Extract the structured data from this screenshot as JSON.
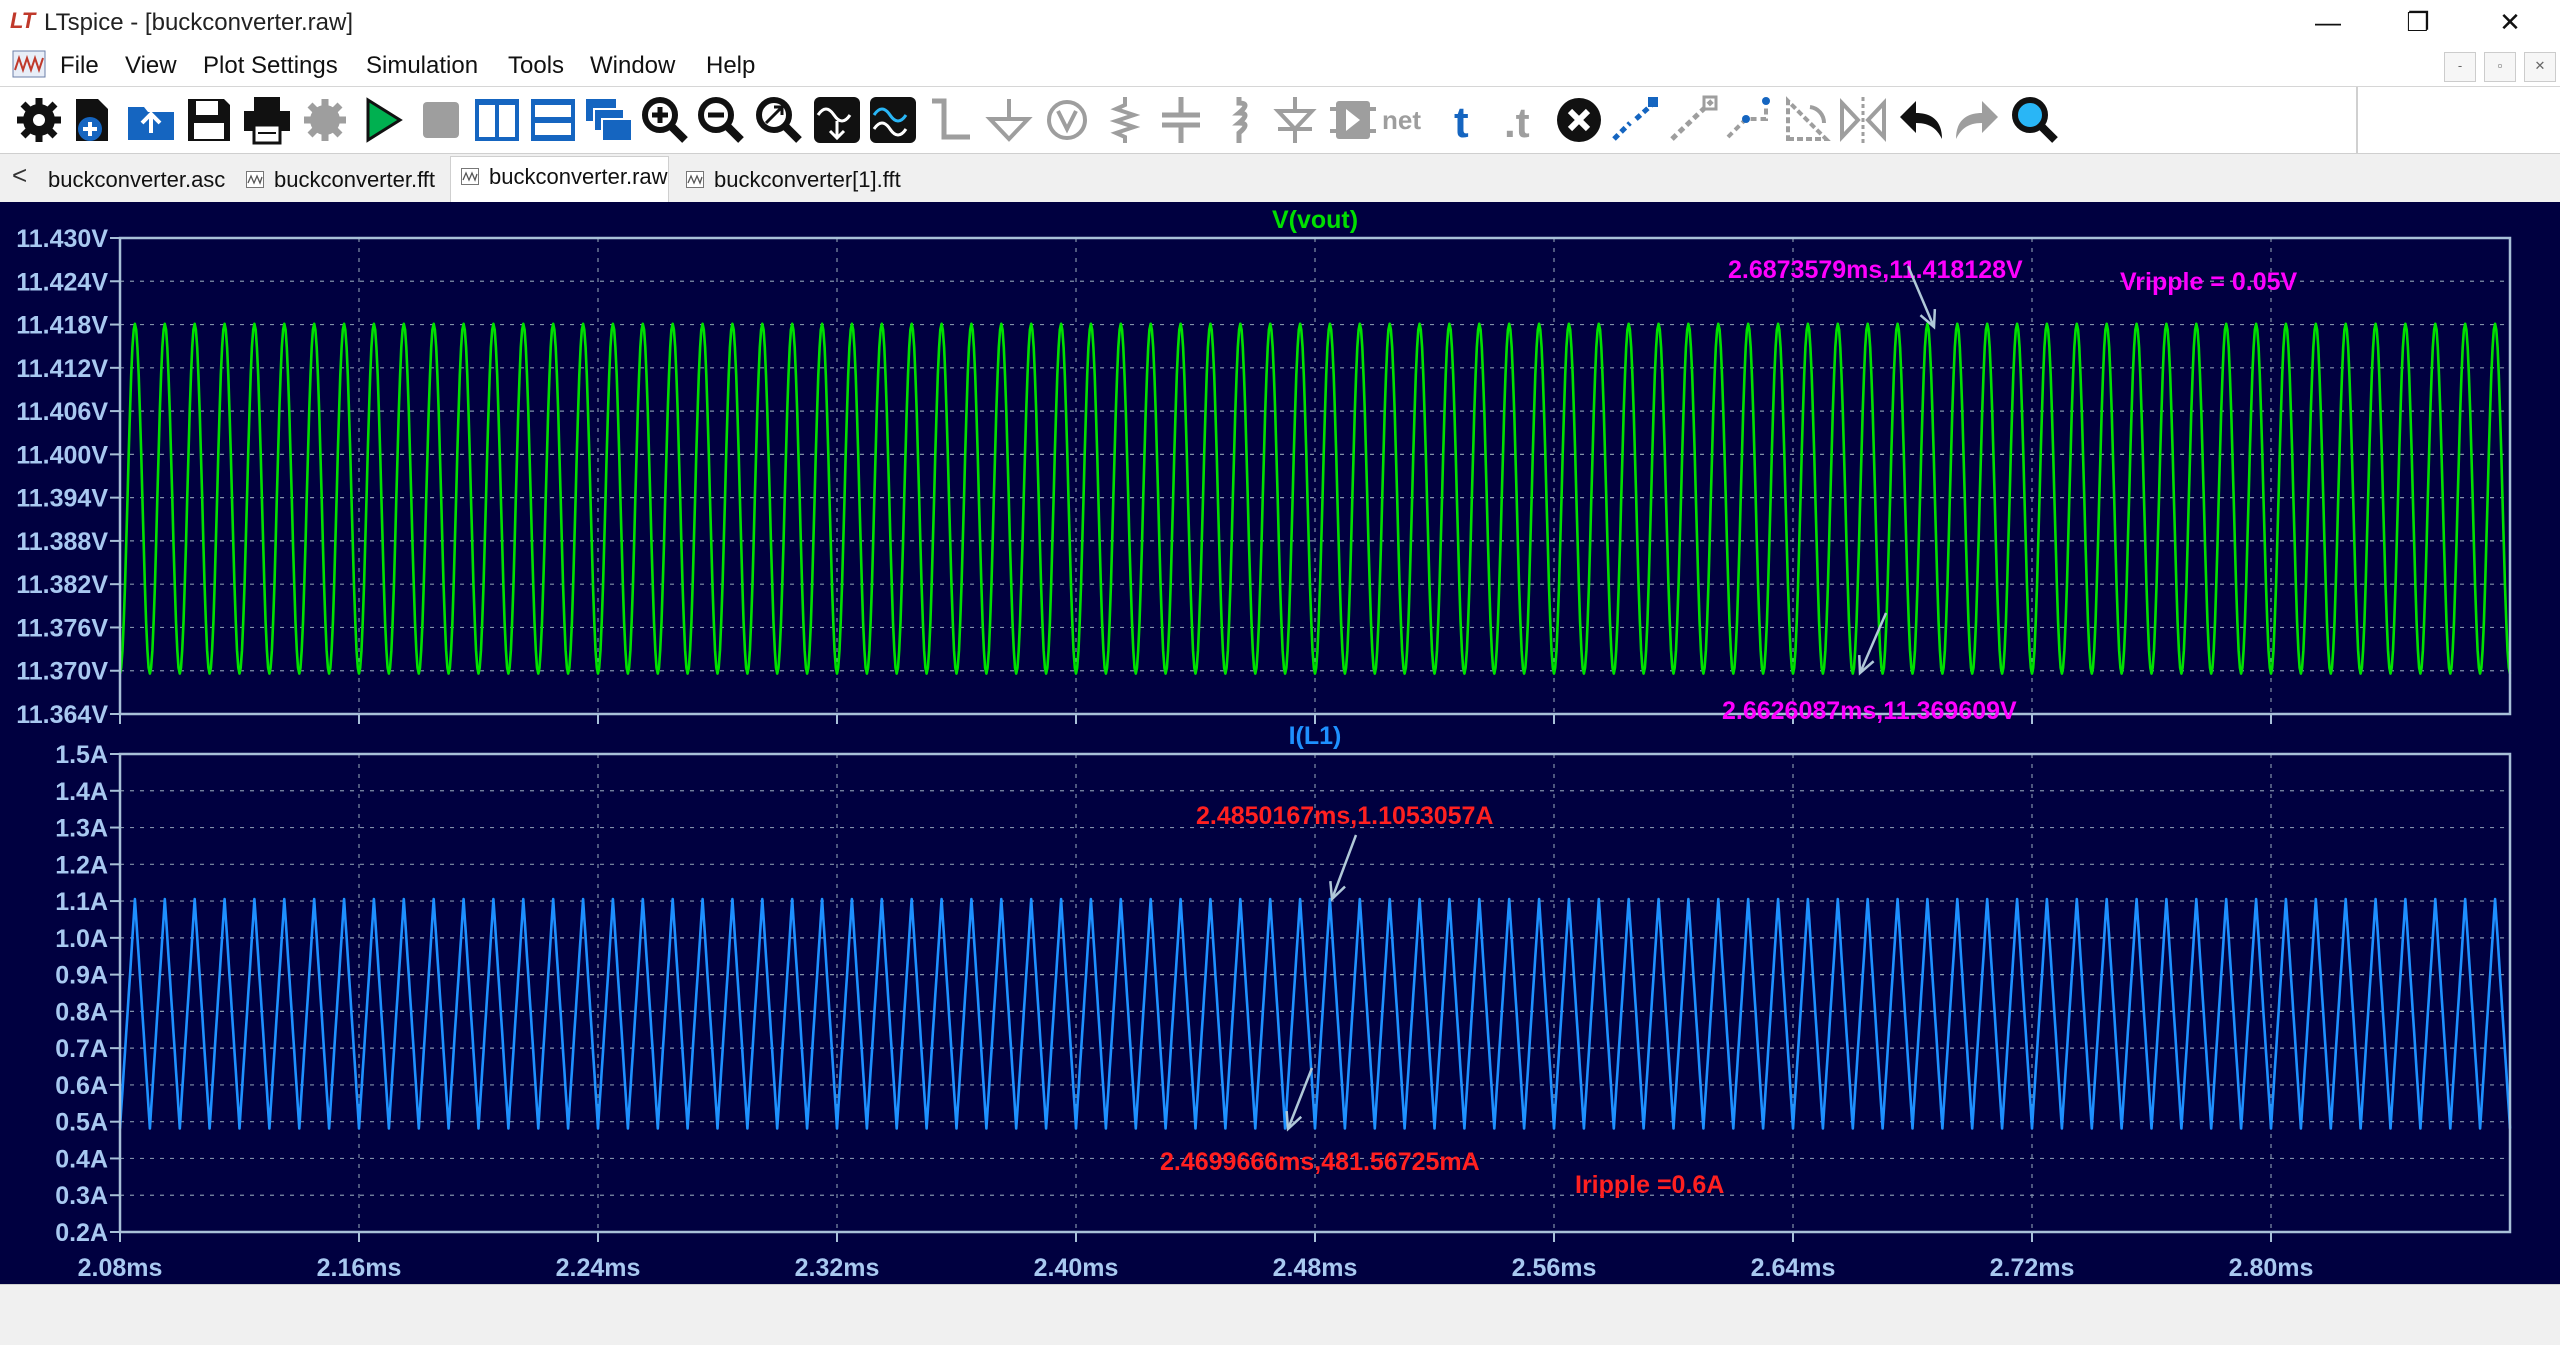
{
  "window": {
    "title": "LTspice - [buckconverter.raw]",
    "logo": "LT",
    "minimize": "—",
    "maximize": "❐",
    "close": "✕"
  },
  "menu": {
    "items": [
      "File",
      "View",
      "Plot Settings",
      "Simulation",
      "Tools",
      "Window",
      "Help"
    ],
    "mdi": [
      "-",
      "▫",
      "✕"
    ]
  },
  "toolbar": {
    "icons": [
      "gear-icon",
      "new-schematic-icon",
      "open-icon",
      "save-icon",
      "print-icon",
      "control-panel-icon",
      "run-icon",
      "halt-icon",
      "tile-vertical-icon",
      "tile-horizontal-icon",
      "cascade-icon",
      "zoom-in-icon",
      "zoom-out-icon",
      "zoom-fit-icon",
      "autorange-icon",
      "fft-icon",
      "wire-icon",
      "ground-icon",
      "label-net-icon",
      "resistor-icon",
      "capacitor-icon",
      "inductor-icon",
      "diode-icon",
      "component-icon",
      "spice-directive-icon",
      "text-icon",
      "spice-text-icon",
      "delete-icon",
      "duplicate-icon",
      "move-icon",
      "drag-icon",
      "rotate-icon",
      "mirror-icon",
      "undo-icon",
      "redo-icon",
      "find-icon"
    ],
    "net_label": "net",
    "text_label": "t",
    "directive_label": ".t"
  },
  "tabs": [
    {
      "label": "buckconverter.asc",
      "active": false,
      "icon": "schematic-tab-icon"
    },
    {
      "label": "buckconverter.fft",
      "active": false,
      "icon": "waveform-tab-icon"
    },
    {
      "label": "buckconverter.raw",
      "active": true,
      "icon": "waveform-tab-icon"
    },
    {
      "label": "buckconverter[1].fft",
      "active": false,
      "icon": "waveform-tab-icon"
    }
  ],
  "tab_back": "<",
  "chart_data": [
    {
      "type": "line",
      "title": "V(vout)",
      "color": "#00e000",
      "x_ticks": [
        "2.08ms",
        "2.16ms",
        "2.24ms",
        "2.32ms",
        "2.40ms",
        "2.48ms",
        "2.56ms",
        "2.64ms",
        "2.72ms",
        "2.80ms"
      ],
      "xlim": [
        2.08,
        2.88
      ],
      "y_ticks": [
        "11.430V",
        "11.424V",
        "11.418V",
        "11.412V",
        "11.406V",
        "11.400V",
        "11.394V",
        "11.388V",
        "11.382V",
        "11.376V",
        "11.370V",
        "11.364V"
      ],
      "ylim": [
        11.364,
        11.43
      ],
      "series": [
        {
          "waveform": "sine",
          "period_ms": 0.01,
          "min": 11.3696,
          "max": 11.4181,
          "x_start": 2.08,
          "x_end": 2.88
        }
      ],
      "grid": true,
      "annotations": [
        {
          "text": "2.6873579ms,11.418128V",
          "x": 2.6873579,
          "y": 11.418128,
          "color": "#ff00ff"
        },
        {
          "text": "2.6626087ms,11.369609V",
          "x": 2.6626087,
          "y": 11.369609,
          "color": "#ff00ff"
        },
        {
          "text": "Vripple = 0.05V",
          "color": "#ff00ff"
        }
      ]
    },
    {
      "type": "line",
      "title": "I(L1)",
      "color": "#1e90ff",
      "x_ticks": [
        "2.08ms",
        "2.16ms",
        "2.24ms",
        "2.32ms",
        "2.40ms",
        "2.48ms",
        "2.56ms",
        "2.64ms",
        "2.72ms",
        "2.80ms"
      ],
      "xlim": [
        2.08,
        2.88
      ],
      "y_ticks": [
        "1.5A",
        "1.4A",
        "1.3A",
        "1.2A",
        "1.1A",
        "1.0A",
        "0.9A",
        "0.8A",
        "0.7A",
        "0.6A",
        "0.5A",
        "0.4A",
        "0.3A",
        "0.2A"
      ],
      "ylim": [
        0.2,
        1.5
      ],
      "series": [
        {
          "waveform": "triangle",
          "period_ms": 0.01,
          "min": 0.4816,
          "max": 1.1053,
          "x_start": 2.08,
          "x_end": 2.88
        }
      ],
      "grid": true,
      "annotations": [
        {
          "text": "2.4850167ms,1.1053057A",
          "x": 2.4850167,
          "y": 1.1053057,
          "color": "#ff2020"
        },
        {
          "text": "2.4699666ms,481.56725mA",
          "x": 2.4699666,
          "y": 0.48156725,
          "color": "#ff2020"
        },
        {
          "text": "Iripple =0.6A",
          "color": "#ff2020"
        }
      ]
    }
  ]
}
